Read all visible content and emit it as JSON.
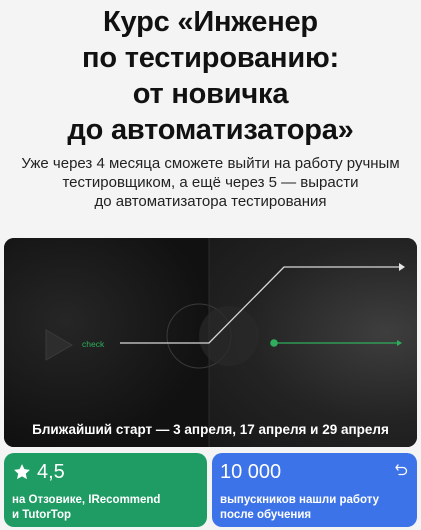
{
  "headline": {
    "lines": [
      "Курс «Инженер",
      "по тестированию:",
      "от новичка",
      "до автоматизатора»"
    ]
  },
  "subtitle": {
    "lines": [
      "Уже через 4 месяца сможете выйти на работу ручным",
      "тестировщиком, а ещё через 5 — вырасти",
      "до автоматизатора тестирования"
    ]
  },
  "hero": {
    "check_label": "check",
    "caption": "Ближайший старт — 3 апреля, 17 апреля и 29 апреля",
    "accent_green": "#2fae5d",
    "icons": [
      "play-icon",
      "arrow-right-icon"
    ]
  },
  "rating_card": {
    "value": "4,5",
    "lines": [
      "на Отзовике, IRecommend",
      "и TutorTop"
    ],
    "color": "#1e9c64",
    "icon": "star-icon"
  },
  "graduates_card": {
    "value": "10 000",
    "lines": [
      "выпускников нашли работу",
      "после обучения"
    ],
    "color": "#3d73e8",
    "icon": "return-arrow-icon"
  }
}
